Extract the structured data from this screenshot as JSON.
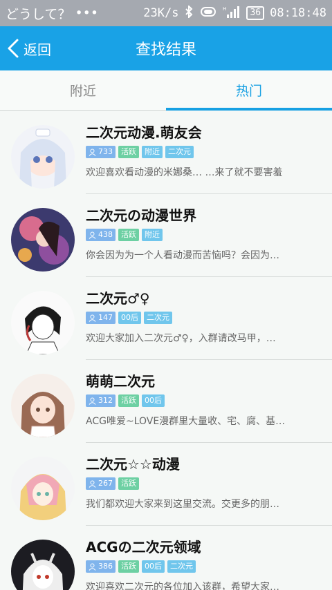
{
  "statusbar": {
    "left_text": "どうして？",
    "dots": "•••",
    "speed": "23K/s",
    "battery": "36",
    "time": "08:18:48"
  },
  "appbar": {
    "back_label": "返回",
    "title": "查找结果"
  },
  "tabs": [
    {
      "label": "附近",
      "active": false
    },
    {
      "label": "热门",
      "active": true
    }
  ],
  "groups": [
    {
      "name": "二次元动漫.萌友会",
      "count": "733",
      "tags": [
        {
          "label": "活跃",
          "color": "green"
        },
        {
          "label": "附近",
          "color": "blue"
        },
        {
          "label": "二次元",
          "color": "blue"
        }
      ],
      "desc": "欢迎喜欢看动漫的米娜桑… …来了就不要害羞"
    },
    {
      "name": "二次元の动漫世界",
      "count": "438",
      "tags": [
        {
          "label": "活跃",
          "color": "green"
        },
        {
          "label": "附近",
          "color": "blue"
        }
      ],
      "desc": "你会因为为一个人看动漫而苦恼吗？会因为…"
    },
    {
      "name": "二次元♂♀",
      "count": "147",
      "tags": [
        {
          "label": "00后",
          "color": "blue"
        },
        {
          "label": "二次元",
          "color": "blue"
        }
      ],
      "desc": "欢迎大家加入二次元♂♀，入群请改马甲，…"
    },
    {
      "name": "萌萌二次元",
      "count": "312",
      "tags": [
        {
          "label": "活跃",
          "color": "green"
        },
        {
          "label": "00后",
          "color": "blue"
        }
      ],
      "desc": "ACG唯爱~LOVE漫群里大量收、宅、腐、基…"
    },
    {
      "name": "二次元☆☆动漫",
      "count": "267",
      "tags": [
        {
          "label": "活跃",
          "color": "green"
        }
      ],
      "desc": "我们都欢迎大家来到这里交流。交更多的朋…"
    },
    {
      "name": "ACGの二次元领域",
      "count": "386",
      "tags": [
        {
          "label": "活跃",
          "color": "green"
        },
        {
          "label": "00后",
          "color": "blue"
        },
        {
          "label": "二次元",
          "color": "blue"
        }
      ],
      "desc": "欢迎喜欢二次元的各位加入该群，希望大家…"
    }
  ],
  "colors": {
    "appbar": "#19a2e6",
    "tab_active": "#17a0e3",
    "tag_count": "#7fb4ec",
    "tag_green": "#6dd0a3",
    "tag_blue": "#70c6ec"
  }
}
